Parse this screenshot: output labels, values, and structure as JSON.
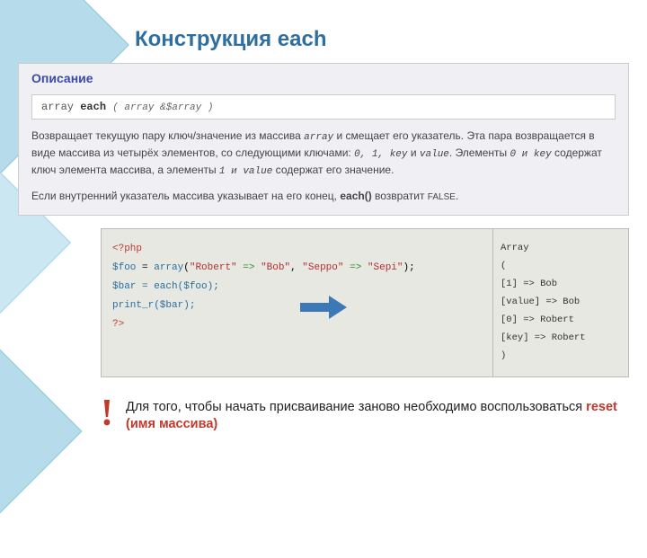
{
  "title": "Конструкция each",
  "desc": {
    "heading": "Описание",
    "sig_return": "array",
    "sig_name": "each",
    "sig_params": "( array &$array )",
    "p1a": "Возвращает текущую пару ключ/значение из массива ",
    "p1_array": "array",
    "p1b": " и смещает его указатель. Эта пара возвращается в виде массива из четырёх элементов, со следующими ключами: ",
    "p1_keys": "0, 1, key",
    "p1c": " и ",
    "p1_value": "value",
    "p1d": ". Элементы ",
    "p1_0key": "0 и key",
    "p1e": " содержат ключ элемента массива, а элементы ",
    "p1_1val": "1 и value",
    "p1f": " содержат его значение.",
    "p2a": "Если внутренний указатель массива указывает на его конец, ",
    "p2_fn": "each()",
    "p2b": " возвратит ",
    "p2_false": "FALSE",
    "p2c": "."
  },
  "code": {
    "l1": "<?php",
    "l2_var": "$foo",
    "l2_eq": " = ",
    "l2_fn": "array",
    "l2_open": "(",
    "l2_k1": "\"Robert\"",
    "l2_arrow": " => ",
    "l2_v1": "\"Bob\"",
    "l2_comma": ", ",
    "l2_k2": "\"Seppo\"",
    "l2_v2": "\"Sepi\"",
    "l2_close": ");",
    "l3_var": "$bar",
    "l3_rest": " = each($foo);",
    "l4": "print_r($bar);",
    "l5": "?>"
  },
  "output": {
    "l1": "Array",
    "l2": "(",
    "l3": "    [1] => Bob",
    "l4": "    [value] => Bob",
    "l5": "    [0] => Robert",
    "l6": "    [key] => Robert",
    "l7": ")"
  },
  "note": {
    "mark": "!",
    "t1": "Для того, чтобы начать присваивание заново необходимо воспользоваться ",
    "reset": "reset (имя массива)"
  }
}
